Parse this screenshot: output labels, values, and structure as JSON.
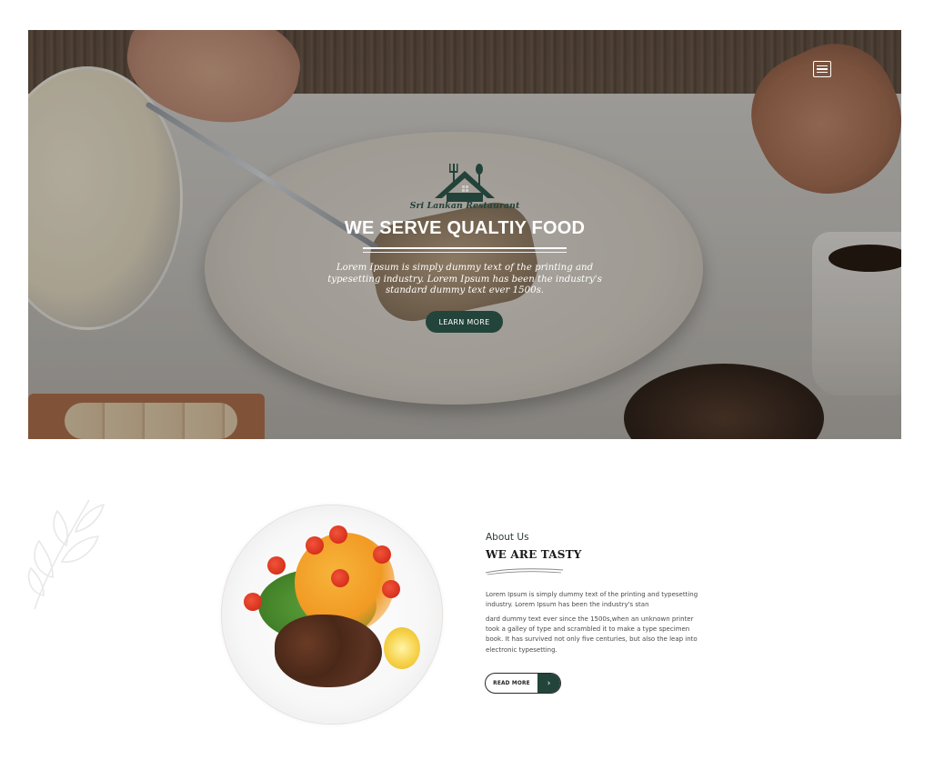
{
  "hero": {
    "logo_text": "Sri Lankan Restaurant",
    "title": "WE SERVE QUALTIY FOOD",
    "subtitle": "Lorem Ipsum is simply dummy text of the printing and typesetting industry. Lorem Ipsum has been the industry's standard dummy text ever 1500s.",
    "cta_label": "LEARN MORE",
    "menu_icon": "hamburger-menu-icon"
  },
  "about": {
    "label": "About Us",
    "title": "WE ARE TASTY",
    "paragraph1": "Lorem Ipsum is simply dummy text of the printing and typesetting industry. Lorem Ipsum has been the industry's stan",
    "paragraph2": "dard dummy text ever since the 1500s,when an unknown printer took a galley of type and scrambled it to make a type specimen book. It has survived not only five centuries, but also the leap into electronic typesetting.",
    "read_more_label": "READ MORE",
    "read_more_arrow": "›"
  },
  "colors": {
    "brand_dark_green": "#23443a",
    "white": "#ffffff",
    "text_dark": "#1b1b1b",
    "text_muted": "#4a4a4a"
  }
}
